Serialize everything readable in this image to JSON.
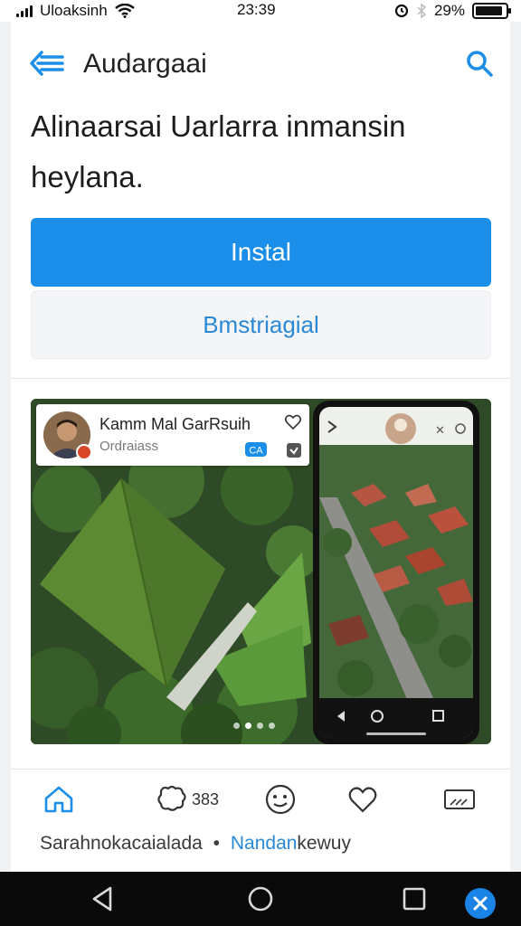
{
  "status_bar": {
    "carrier": "Uloaksinh",
    "time": "23:39",
    "battery_text": "29%",
    "battery_level": 0.9,
    "icons": [
      "signal-icon",
      "wifi-icon",
      "alarm-icon",
      "bluetooth-icon",
      "battery-icon"
    ]
  },
  "app_bar": {
    "title": "Audargaai",
    "back_icon": "menu-back-icon",
    "search_icon": "search-icon"
  },
  "description": "Alinaarsai Uarlarra inmansin heylana.",
  "buttons": {
    "install_label": "Instal",
    "secondary_label": "Bmstriagial"
  },
  "media": {
    "profile_name": "Kamm Mal GarRsuih",
    "profile_subtitle": "Ordraiass",
    "page_count": 4,
    "active_page": 1
  },
  "actions": {
    "home_icon": "home-icon",
    "comment_icon": "comment-icon",
    "comment_count": "383",
    "emoji_icon": "emoji-icon",
    "like_icon": "heart-icon",
    "cast_icon": "cast-icon"
  },
  "footer": {
    "text": "Sarahnokacaialada",
    "separator": "•",
    "link": "Nandan",
    "link_suffix": "kewuy"
  },
  "colors": {
    "accent": "#1a8ee8",
    "link": "#2a88d4",
    "fab": "#1a84e6"
  }
}
